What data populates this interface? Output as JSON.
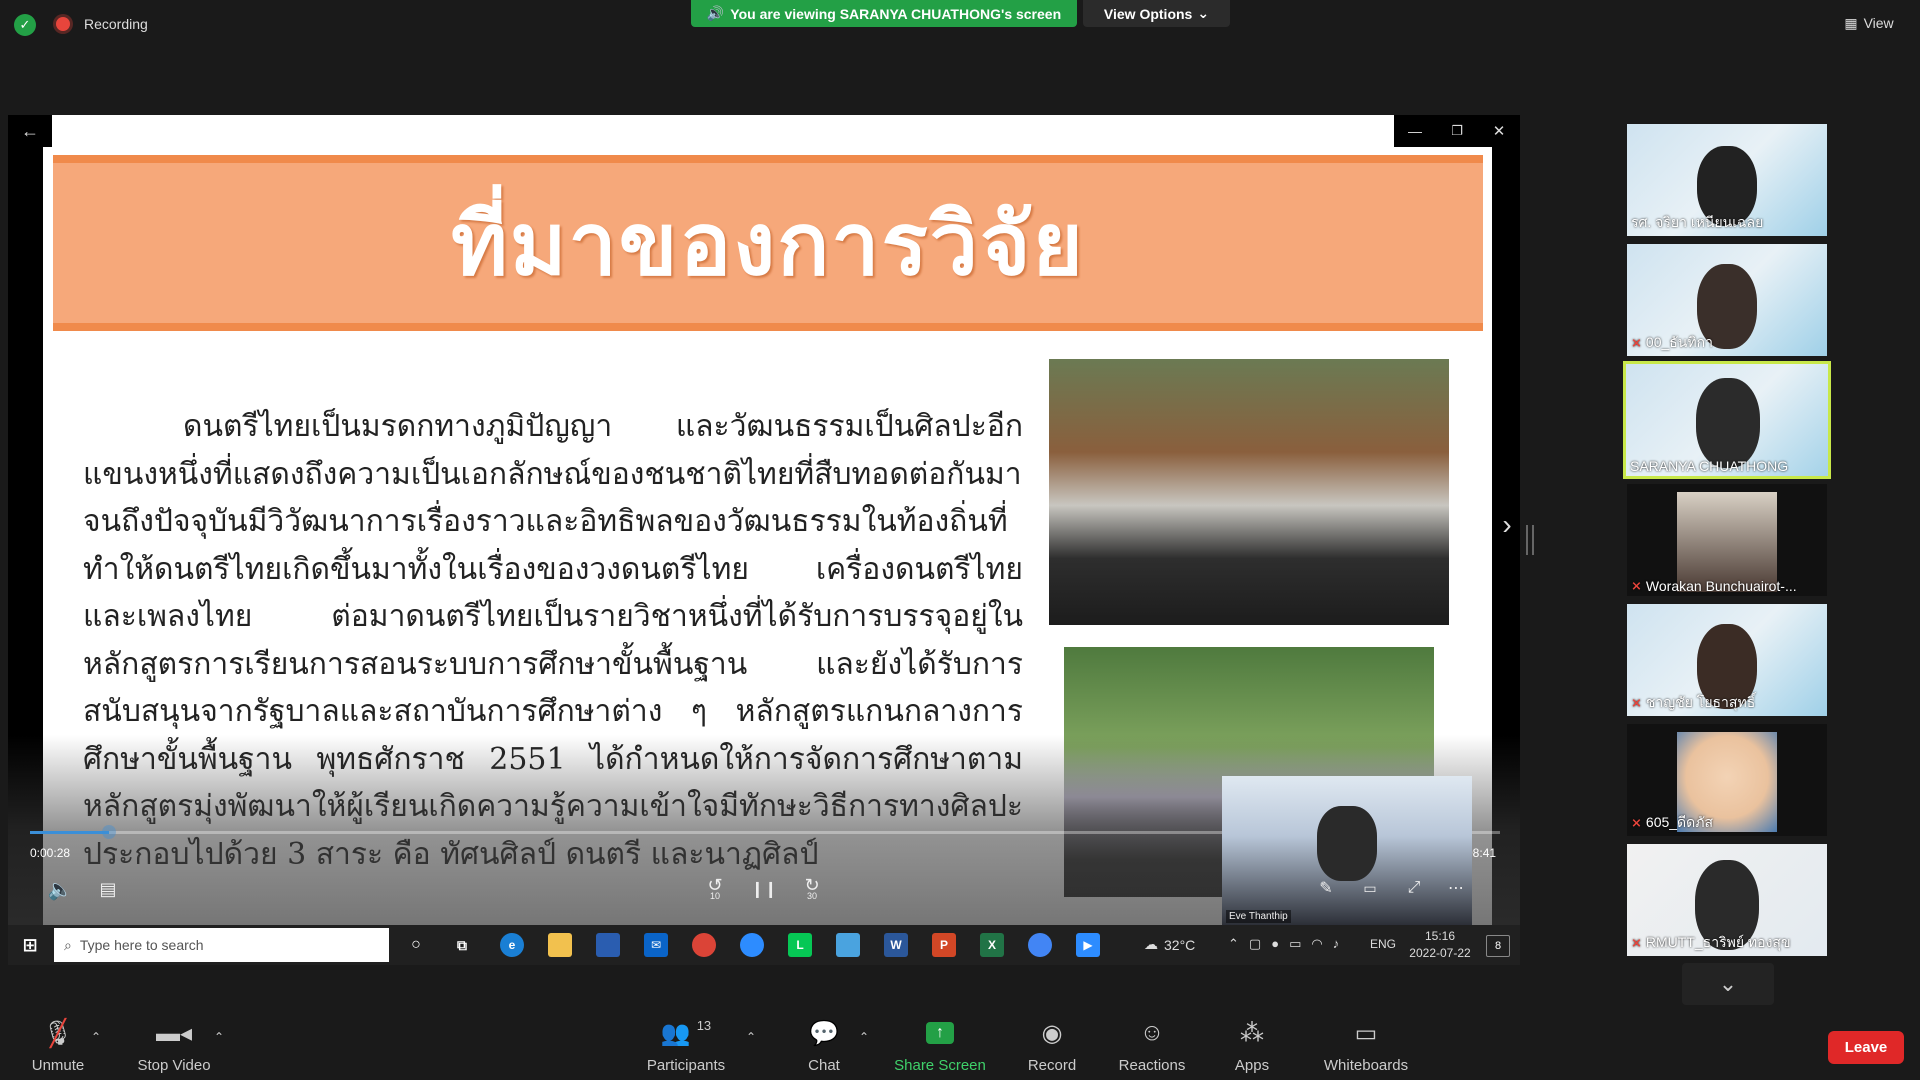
{
  "top": {
    "recording_label": "Recording",
    "viewing_banner": "You are viewing SARANYA CHUATHONG's screen",
    "view_options": "View Options",
    "view_label": "View"
  },
  "slide": {
    "title": "ที่มาของการวิจัย",
    "body": "ดนตรีไทยเป็นมรดกทางภูมิปัญญา และวัฒนธรรมเป็นศิลปะอีกแขนงหนึ่งที่แสดงถึงความเป็นเอกลักษณ์ของชนชาติไทยที่สืบทอดต่อกันมา จนถึงปัจจุบันมีวิวัฒนาการเรื่องราวและอิทธิพลของวัฒนธรรมในท้องถิ่นที่ทำให้ดนตรีไทยเกิดขึ้นมาทั้งในเรื่องของวงดนตรีไทย เครื่องดนตรีไทย และเพลงไทย ต่อมาดนตรีไทยเป็นรายวิชาหนึ่งที่ได้รับการบรรจุอยู่ในหลักสูตรการเรียนการสอนระบบการศึกษาขั้นพื้นฐาน และยังได้รับการสนับสนุนจากรัฐบาลและสถาบันการศึกษาต่าง ๆ หลักสูตรแกนกลางการศึกษาขั้นพื้นฐาน พุทธศักราช 2551 ได้กำหนดให้การจัดการศึกษาตามหลักสูตรมุ่งพัฒนาให้ผู้เรียนเกิดความรู้ความเข้าใจมีทักษะวิธีการทางศิลปะ ประกอบไปด้วย 3 สาระ คือ ทัศนศิลป์ ดนตรี และนาฏศิลป์"
  },
  "player": {
    "time_current": "0:00:28",
    "time_total": "0:08:41",
    "progress": 0.054,
    "pip_name": "Eve Thanthip",
    "skip_back": "10",
    "skip_forward": "30"
  },
  "taskbar": {
    "search_placeholder": "Type here to search",
    "weather": "32°C",
    "lang": "ENG",
    "time": "15:16",
    "date": "2022-07-22",
    "notif_count": "8"
  },
  "gallery": [
    {
      "name": "รศ. จริยา เหนียนเฉลย",
      "muted": false,
      "active": false
    },
    {
      "name": "00_ธันทิกา",
      "muted": true,
      "active": false
    },
    {
      "name": "SARANYA CHUATHONG",
      "muted": false,
      "active": true
    },
    {
      "name": "Worakan Bunchuairot-...",
      "muted": true,
      "active": false
    },
    {
      "name": "ชาญชัย โยธาสุทธิ์",
      "muted": true,
      "active": false
    },
    {
      "name": "605_ดีดภัส",
      "muted": true,
      "active": false
    },
    {
      "name": "RMUTT_ธาริพย์ ทองสุข",
      "muted": true,
      "active": false
    }
  ],
  "toolbar": {
    "unmute": "Unmute",
    "stop_video": "Stop Video",
    "participants": "Participants",
    "participants_count": "13",
    "chat": "Chat",
    "share_screen": "Share Screen",
    "record": "Record",
    "reactions": "Reactions",
    "apps": "Apps",
    "whiteboards": "Whiteboards",
    "leave": "Leave"
  },
  "colors": {
    "accent_green": "#23a046",
    "slide_orange": "#f6a87a",
    "leave_red": "#e02828"
  }
}
